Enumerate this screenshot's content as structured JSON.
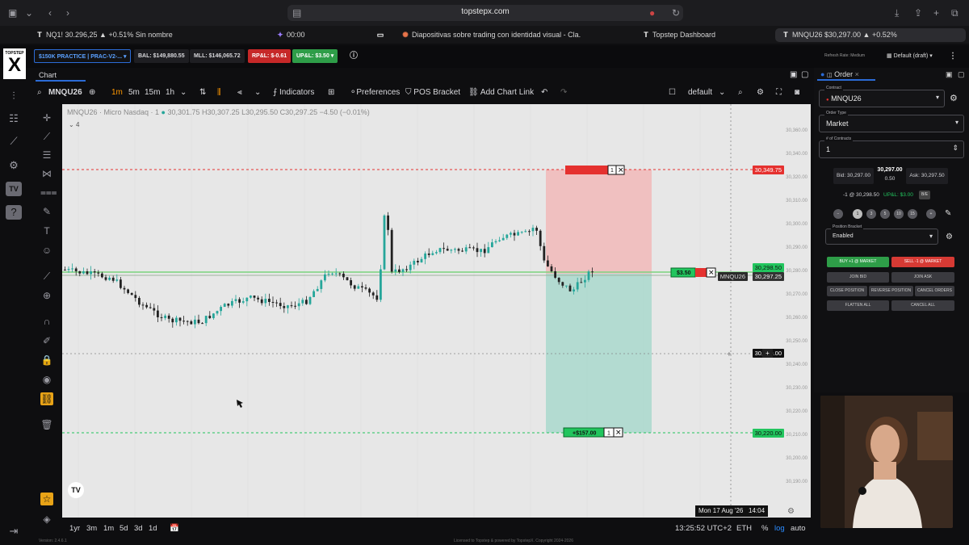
{
  "browser": {
    "url": "topstepx.com",
    "tabs": [
      {
        "label": "NQ1! 30.296,25 ▲ +0.51% Sin nombre"
      },
      {
        "label": "00:00"
      },
      {
        "label": "Diapositivas sobre trading con identidad visual - Cla..."
      },
      {
        "label": "Topstep Dashboard"
      },
      {
        "label": "MNQU26 $30,297.00 ▲ +0.52%"
      }
    ]
  },
  "header": {
    "logo_text": "TOPSTEP",
    "logo_mark": "X",
    "account": "$150K PRACTICE | PRAC-V2-...",
    "bal": "BAL: $149,880.55",
    "mll": "MLL: $146,065.72",
    "rpnl": "RP&L: $-0.61",
    "upnl": "UP&L: $3.50",
    "refresh_rate": "Refresh Rate: Medium",
    "layout": "Default (draft)"
  },
  "chart_panel": {
    "tab_label": "Chart",
    "symbol": "MNQU26",
    "timeframes": [
      "1m",
      "5m",
      "15m",
      "1h"
    ],
    "indicators_label": "Indicators",
    "preferences_label": "Preferences",
    "pos_bracket_label": "POS Bracket",
    "add_chart_link_label": "Add Chart Link",
    "template_label": "default",
    "legend_title": "MNQU26 · Micro Nasdaq · 1",
    "legend_ohlc": "30,301.75  H30,307.25  L30,295.50  C30,297.25  −4.50 (−0.01%)",
    "legend_count": "4",
    "ranges": [
      "1yr",
      "3m",
      "1m",
      "5d",
      "3d",
      "1d"
    ],
    "clock": "13:25:52 UTC+2",
    "session": "ETH",
    "pct": "%",
    "log": "log",
    "auto": "auto",
    "cursor_date": "Mon 17 Aug '26   14:04",
    "order_labels": {
      "stop_price": "30,349.75",
      "current_price": "30,298.50",
      "last_price": "30,297.25",
      "cursor_price": "30,259.00",
      "target_price": "30,220.00",
      "position_pnl": "$3.50",
      "target_pnl": "+$157.00",
      "symbol_tag": "MNQU26",
      "target_qty": "1",
      "stop_qty": "1"
    },
    "y_ticks": [
      "30,360.00",
      "30,340.00",
      "30,320.00",
      "30,310.00",
      "30,300.00",
      "30,290.00",
      "30,280.00",
      "30,270.00",
      "30,260.00",
      "30,250.00",
      "30,240.00",
      "30,230.00",
      "30,220.00",
      "30,210.00",
      "30,200.00",
      "30,190.00"
    ]
  },
  "order_panel": {
    "tab_label": "Order",
    "contract_label": "Contract",
    "contract": "MNQU26",
    "order_type_label": "Order Type",
    "order_type": "Market",
    "contracts_label": "# of Contracts",
    "contracts": "1",
    "bid": "Bid: 30,297.00",
    "last": "30,297.00",
    "spread": "0.50",
    "ask": "Ask: 30,297.50",
    "position": "-1 @ 30,298.50",
    "upnl": "UP&L: $3.00",
    "be_label": "B/E",
    "qty_presets": [
      "1",
      "3",
      "5",
      "10",
      "15"
    ],
    "bracket_label": "Position Bracket",
    "bracket_value": "Enabled",
    "buttons": {
      "buy": "BUY +1 @ MARKET",
      "sell": "SELL -1 @ MARKET",
      "join_bid": "JOIN BID",
      "join_ask": "JOIN ASK",
      "close": "CLOSE POSITION",
      "reverse": "REVERSE POSITION",
      "cancel_orders": "CANCEL ORDERS",
      "flatten": "FLATTEN ALL",
      "cancel_all": "CANCEL ALL"
    }
  },
  "footer": {
    "version": "Version: 2.4.6.1",
    "license": "Licensed to Topstep & powered by TopstepX. Copyright 2024-2026"
  },
  "colors": {
    "stop_red": "#e5312f",
    "target_green": "#22c55e",
    "candle_up": "#26a69a",
    "candle_down": "#222222"
  }
}
